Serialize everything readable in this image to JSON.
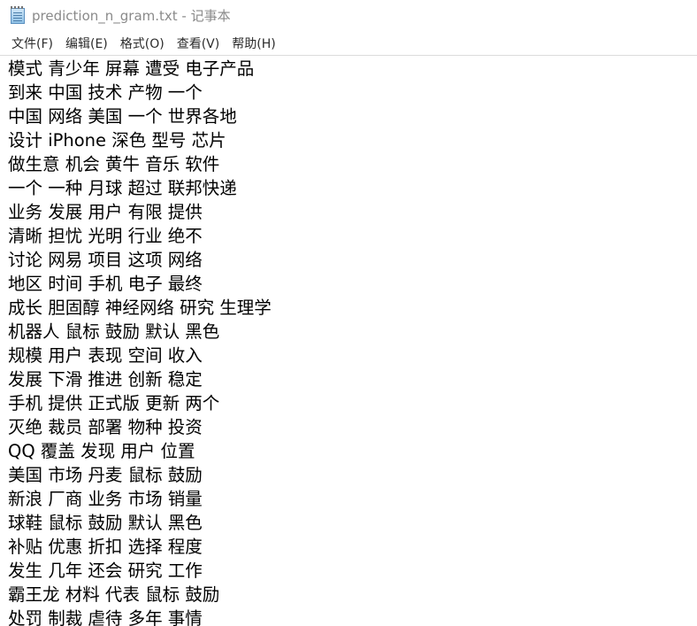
{
  "window": {
    "title": "prediction_n_gram.txt - 记事本"
  },
  "menu": [
    {
      "label": "文件(F)"
    },
    {
      "label": "编辑(E)"
    },
    {
      "label": "格式(O)"
    },
    {
      "label": "查看(V)"
    },
    {
      "label": "帮助(H)"
    }
  ],
  "document": {
    "lines": [
      "模式 青少年 屏幕 遭受 电子产品",
      "到来 中国 技术 产物 一个",
      "中国 网络 美国 一个 世界各地",
      "设计 iPhone 深色 型号 芯片",
      "做生意 机会 黄牛 音乐 软件",
      "一个 一种 月球 超过 联邦快递",
      "业务 发展 用户 有限 提供",
      "清晰 担忧 光明 行业 绝不",
      "讨论 网易 项目 这项 网络",
      "地区 时间 手机 电子 最终",
      "成长 胆固醇 神经网络 研究 生理学",
      "机器人 鼠标 鼓励 默认 黑色",
      "规模 用户 表现 空间 收入",
      "发展 下滑 推进 创新 稳定",
      "手机 提供 正式版 更新 两个",
      "灭绝 裁员 部署 物种 投资",
      "QQ 覆盖 发现 用户 位置",
      "美国 市场 丹麦 鼠标 鼓励",
      "新浪 厂商 业务 市场 销量",
      "球鞋 鼠标 鼓励 默认 黑色",
      "补贴 优惠 折扣 选择 程度",
      "发生 几年 还会 研究 工作",
      "霸王龙 材料 代表 鼠标 鼓励",
      "处罚 制裁 虐待 多年 事情"
    ]
  }
}
